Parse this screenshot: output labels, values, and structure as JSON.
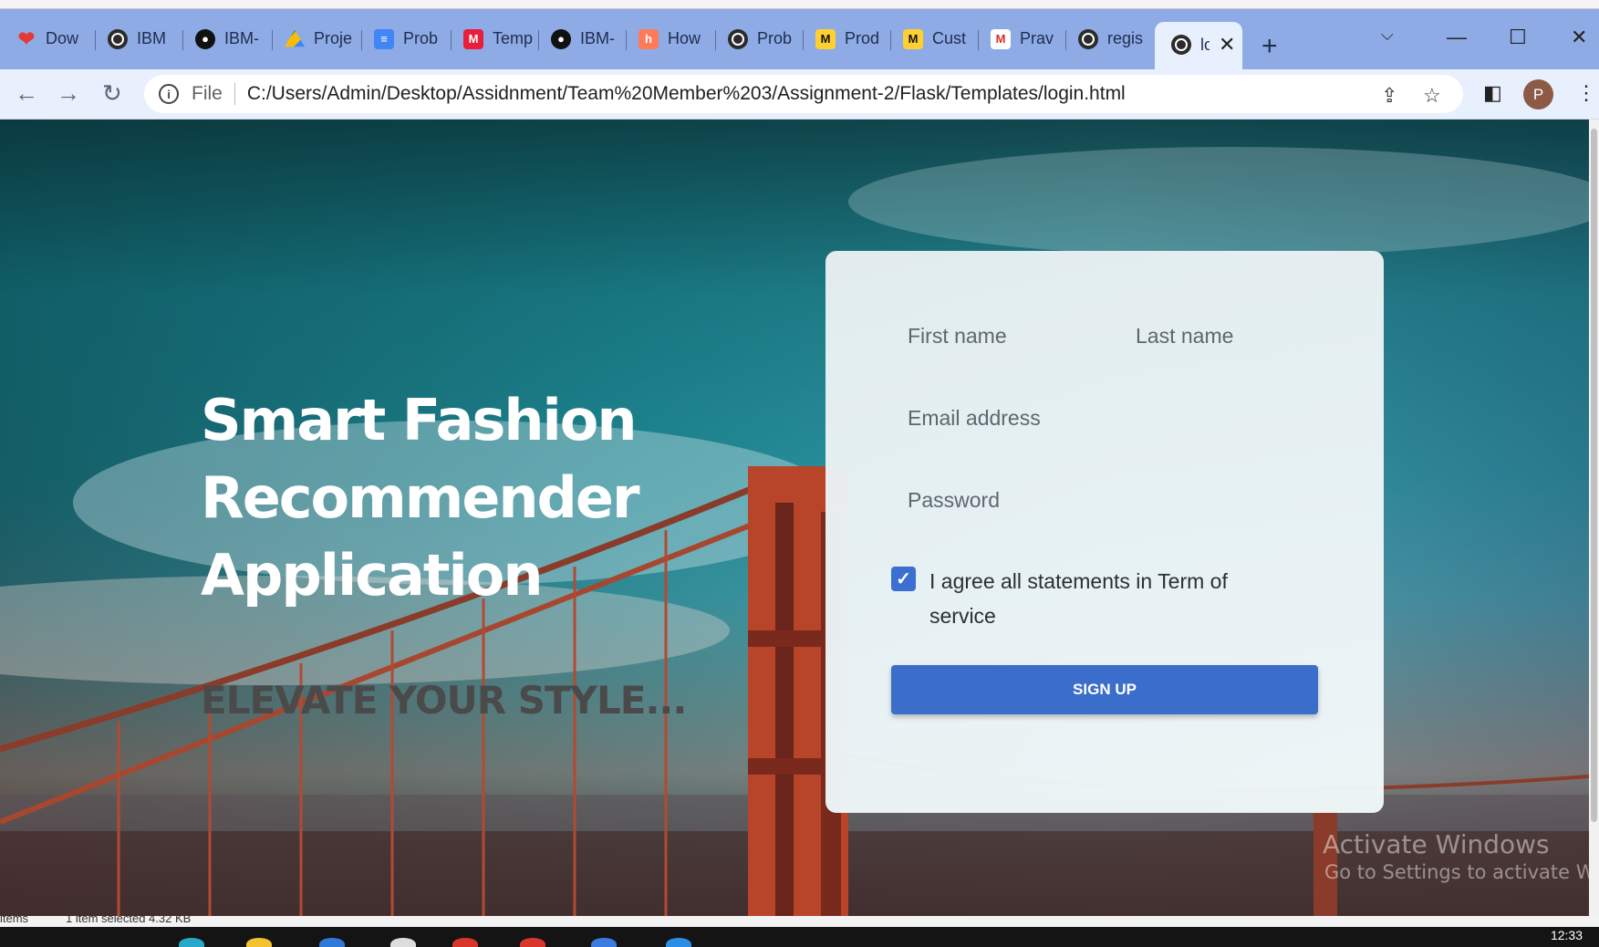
{
  "browser": {
    "tabs": [
      {
        "label": "Dow",
        "icon": "heart-icon"
      },
      {
        "label": "IBM",
        "icon": "globe-icon"
      },
      {
        "label": "IBM-",
        "icon": "github-icon"
      },
      {
        "label": "Proje",
        "icon": "drive-icon"
      },
      {
        "label": "Prob",
        "icon": "docs-icon"
      },
      {
        "label": "Temp",
        "icon": "miro-icon"
      },
      {
        "label": "IBM-",
        "icon": "github-icon"
      },
      {
        "label": "How",
        "icon": "hubspot-icon"
      },
      {
        "label": "Prob",
        "icon": "globe-icon"
      },
      {
        "label": "Prod",
        "icon": "miro-yellow-icon"
      },
      {
        "label": "Cust",
        "icon": "miro-yellow-icon"
      },
      {
        "label": "Prav",
        "icon": "gmail-icon"
      },
      {
        "label": "regis",
        "icon": "globe-icon"
      },
      {
        "label": "lo",
        "icon": "globe-icon"
      }
    ],
    "address": {
      "scheme_label": "File",
      "url": "C:/Users/Admin/Desktop/Assidnment/Team%20Member%203/Assignment-2/Flask/Templates/login.html"
    },
    "profile_initial": "P"
  },
  "page": {
    "hero_title_lines": [
      "Smart Fashion",
      "Recommender",
      "Application"
    ],
    "hero_subtitle": "ELEVATE YOUR STYLE...",
    "form": {
      "first_name_placeholder": "First name",
      "last_name_placeholder": "Last name",
      "email_placeholder": "Email address",
      "password_placeholder": "Password",
      "agree_checked": true,
      "agree_text": "I agree all statements in Term of service",
      "signup_label": "SIGN UP"
    }
  },
  "os": {
    "watermark_title": "Activate Windows",
    "watermark_sub": "Go to Settings to activate Windows.",
    "status_left": "items",
    "status_selected": "1 item selected  4.32 KB",
    "clock": "12:33"
  },
  "colors": {
    "accent": "#3b6dcb",
    "tabstrip": "#8eabe6",
    "toolbar": "#e8effd"
  }
}
